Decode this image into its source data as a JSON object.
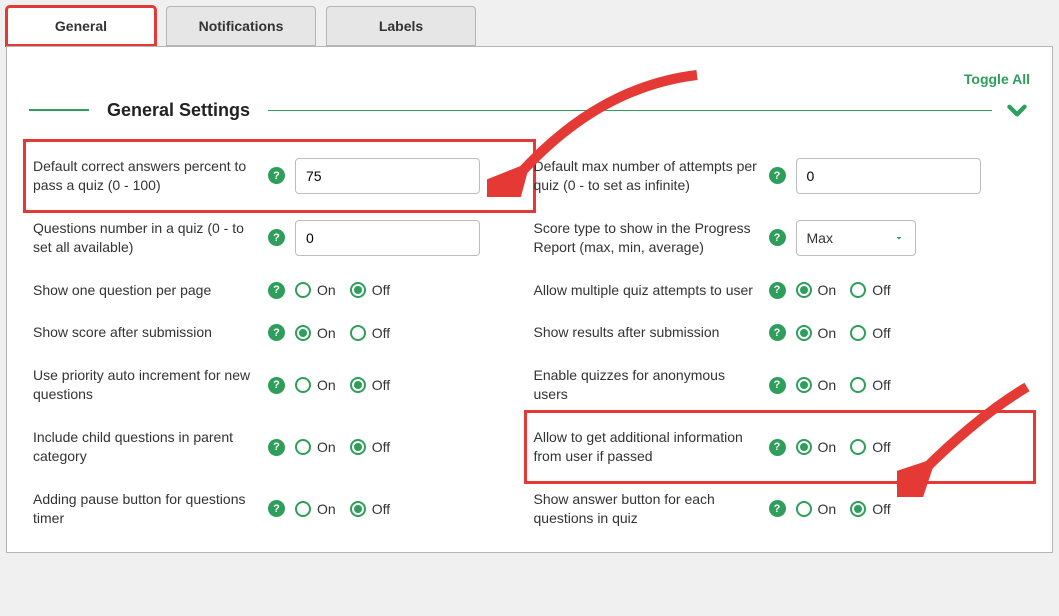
{
  "tabs": {
    "general": "General",
    "notifications": "Notifications",
    "labels": "Labels"
  },
  "toggle_all": "Toggle All",
  "section_title": "General Settings",
  "radio_labels": {
    "on": "On",
    "off": "Off"
  },
  "help_char": "?",
  "left": {
    "pass_percent": {
      "label": "Default correct answers percent to pass a quiz (0 - 100)",
      "value": "75"
    },
    "questions_num": {
      "label": "Questions number in a quiz (0 - to set all available)",
      "value": "0"
    },
    "one_per_page": {
      "label": "Show one question per page",
      "value": "off"
    },
    "show_score": {
      "label": "Show score after submission",
      "value": "on"
    },
    "priority_auto": {
      "label": "Use priority auto increment for new questions",
      "value": "off"
    },
    "include_child": {
      "label": "Include child questions in parent category",
      "value": "off"
    },
    "pause_button": {
      "label": "Adding pause button for questions timer",
      "value": "off"
    }
  },
  "right": {
    "max_attempts": {
      "label": "Default max number of attempts per quiz (0 - to set as infinite)",
      "value": "0"
    },
    "score_type": {
      "label": "Score type to show in the Progress Report (max, min, average)",
      "value": "Max"
    },
    "allow_multi": {
      "label": "Allow multiple quiz attempts to user",
      "value": "on"
    },
    "show_results": {
      "label": "Show results after submission",
      "value": "on"
    },
    "anon_users": {
      "label": "Enable quizzes for anonymous users",
      "value": "on"
    },
    "additional_info": {
      "label": "Allow to get additional information from user if passed",
      "value": "on"
    },
    "show_answer_btn": {
      "label": "Show answer button for each questions in quiz",
      "value": "off"
    }
  }
}
